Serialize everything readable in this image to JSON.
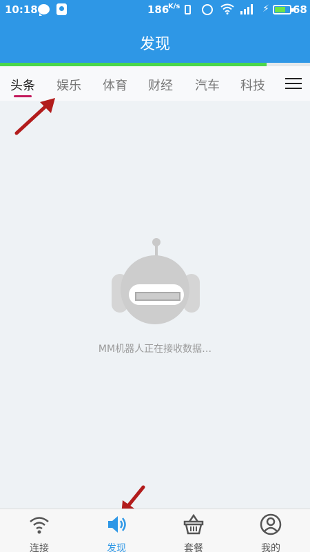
{
  "status_bar": {
    "time": "10:18",
    "speed": "186",
    "speed_unit": "K/s",
    "battery_level": "68"
  },
  "header": {
    "title": "发现"
  },
  "load_progress": 0.86,
  "tabs": [
    {
      "label": "头条",
      "active": true
    },
    {
      "label": "娱乐",
      "active": false
    },
    {
      "label": "体育",
      "active": false
    },
    {
      "label": "财经",
      "active": false
    },
    {
      "label": "汽车",
      "active": false
    },
    {
      "label": "科技",
      "active": false
    }
  ],
  "main": {
    "loading_text": "MM机器人正在接收数据…"
  },
  "bottom_nav": [
    {
      "label": "连接",
      "icon": "wifi-icon",
      "active": false
    },
    {
      "label": "发现",
      "icon": "speaker-icon",
      "active": true
    },
    {
      "label": "套餐",
      "icon": "basket-icon",
      "active": false
    },
    {
      "label": "我的",
      "icon": "user-icon",
      "active": false
    }
  ],
  "colors": {
    "primary": "#2e97e6",
    "progress": "#4bd64b",
    "tab_indicator": "#c2185b",
    "annotation_arrow": "#b21c1c"
  }
}
